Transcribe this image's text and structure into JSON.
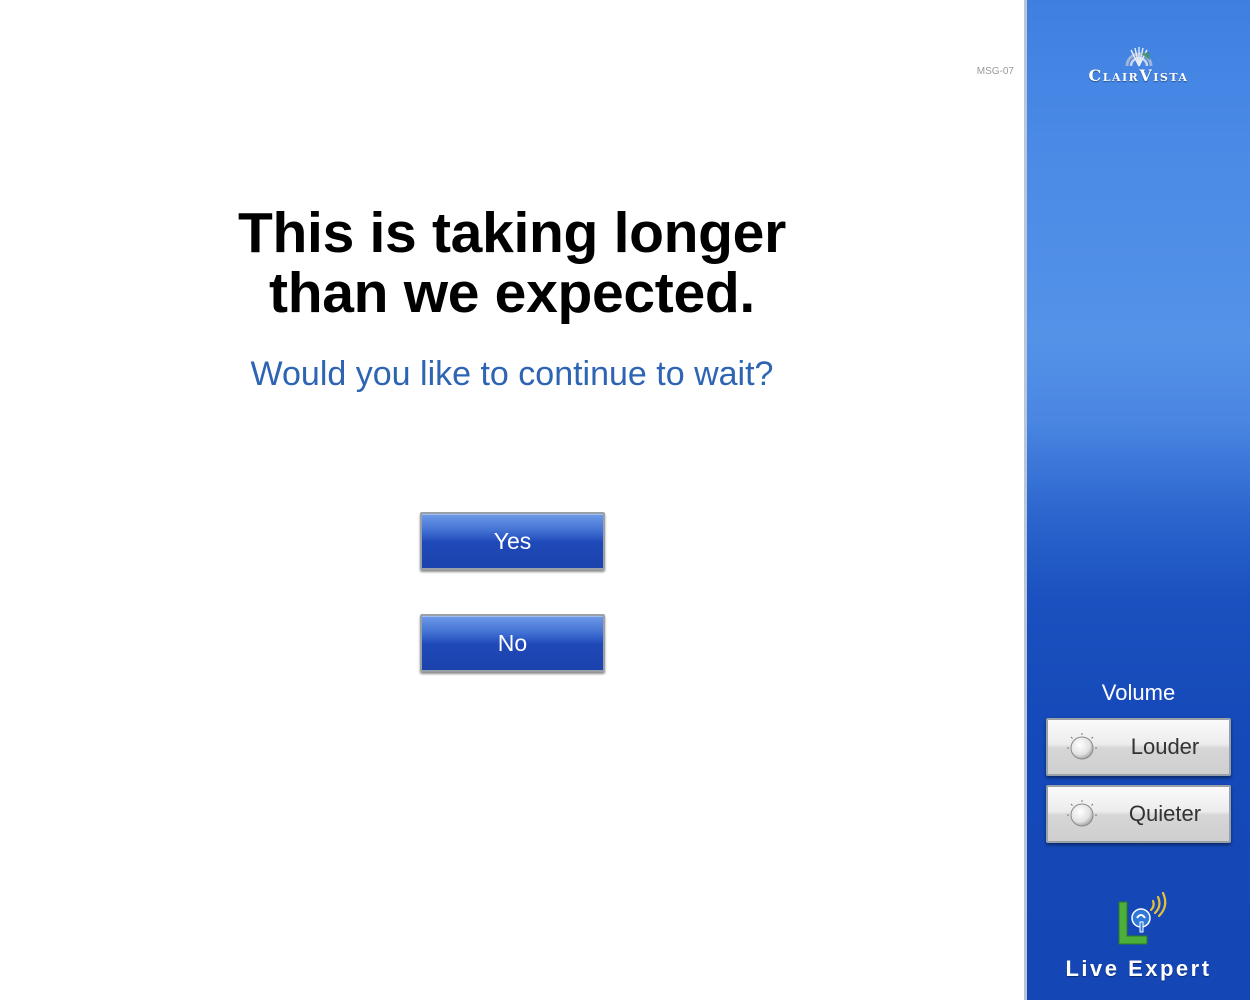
{
  "screen_code": "MSG-07",
  "dialog": {
    "headline_line1": "This is taking longer",
    "headline_line2": "than we expected.",
    "question": "Would you like to continue to wait?",
    "yes_label": "Yes",
    "no_label": "No"
  },
  "sidebar": {
    "brand": "ClairVista",
    "volume_label": "Volume",
    "louder_label": "Louder",
    "quieter_label": "Quieter",
    "footer_brand": "Live Expert"
  },
  "icons": {
    "brand_logo": "clairvista-logo-icon",
    "knob": "volume-knob-icon",
    "live_expert_logo": "live-expert-logo-icon"
  },
  "colors": {
    "question_text": "#2e64b4",
    "button_blue": "#1f49b8",
    "sidebar_blue": "#1548b8"
  }
}
